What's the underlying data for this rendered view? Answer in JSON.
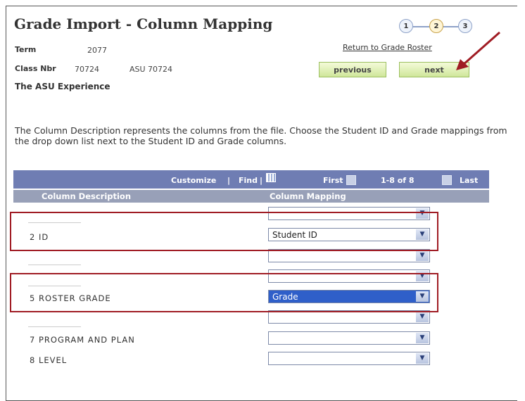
{
  "page": {
    "title": "Grade Import - Column Mapping",
    "steps": [
      "1",
      "2",
      "3"
    ],
    "active_step": 2
  },
  "info": {
    "term_label": "Term",
    "term_value": "2077",
    "class_nbr_label": "Class Nbr",
    "class_nbr_value": "70724",
    "class_code": "ASU 70724",
    "class_name": "The ASU Experience"
  },
  "actions": {
    "return_link": "Return to Grade Roster",
    "previous": "previous",
    "next": "next"
  },
  "description": "The Column Description represents the columns from the file. Choose the Student ID and Grade mappings from the drop down list next to the Student ID and Grade columns.",
  "grid": {
    "customize": "Customize",
    "find": "Find",
    "first": "First",
    "range": "1-8 of 8",
    "last": "Last",
    "col_description": "Column Description",
    "col_mapping": "Column Mapping",
    "rows": [
      {
        "label": "",
        "mapping": ""
      },
      {
        "label": "2 ID",
        "mapping": "Student ID"
      },
      {
        "label": "",
        "mapping": ""
      },
      {
        "label": "",
        "mapping": ""
      },
      {
        "label": "5 ROSTER GRADE",
        "mapping": "Grade"
      },
      {
        "label": "",
        "mapping": ""
      },
      {
        "label": "7 PROGRAM AND PLAN",
        "mapping": ""
      },
      {
        "label": "8 LEVEL",
        "mapping": ""
      }
    ]
  },
  "colors": {
    "grid_bar": "#6f7db3",
    "header_row": "#98a0b8",
    "highlight": "#a01c24",
    "selected": "#2f5fc9"
  }
}
